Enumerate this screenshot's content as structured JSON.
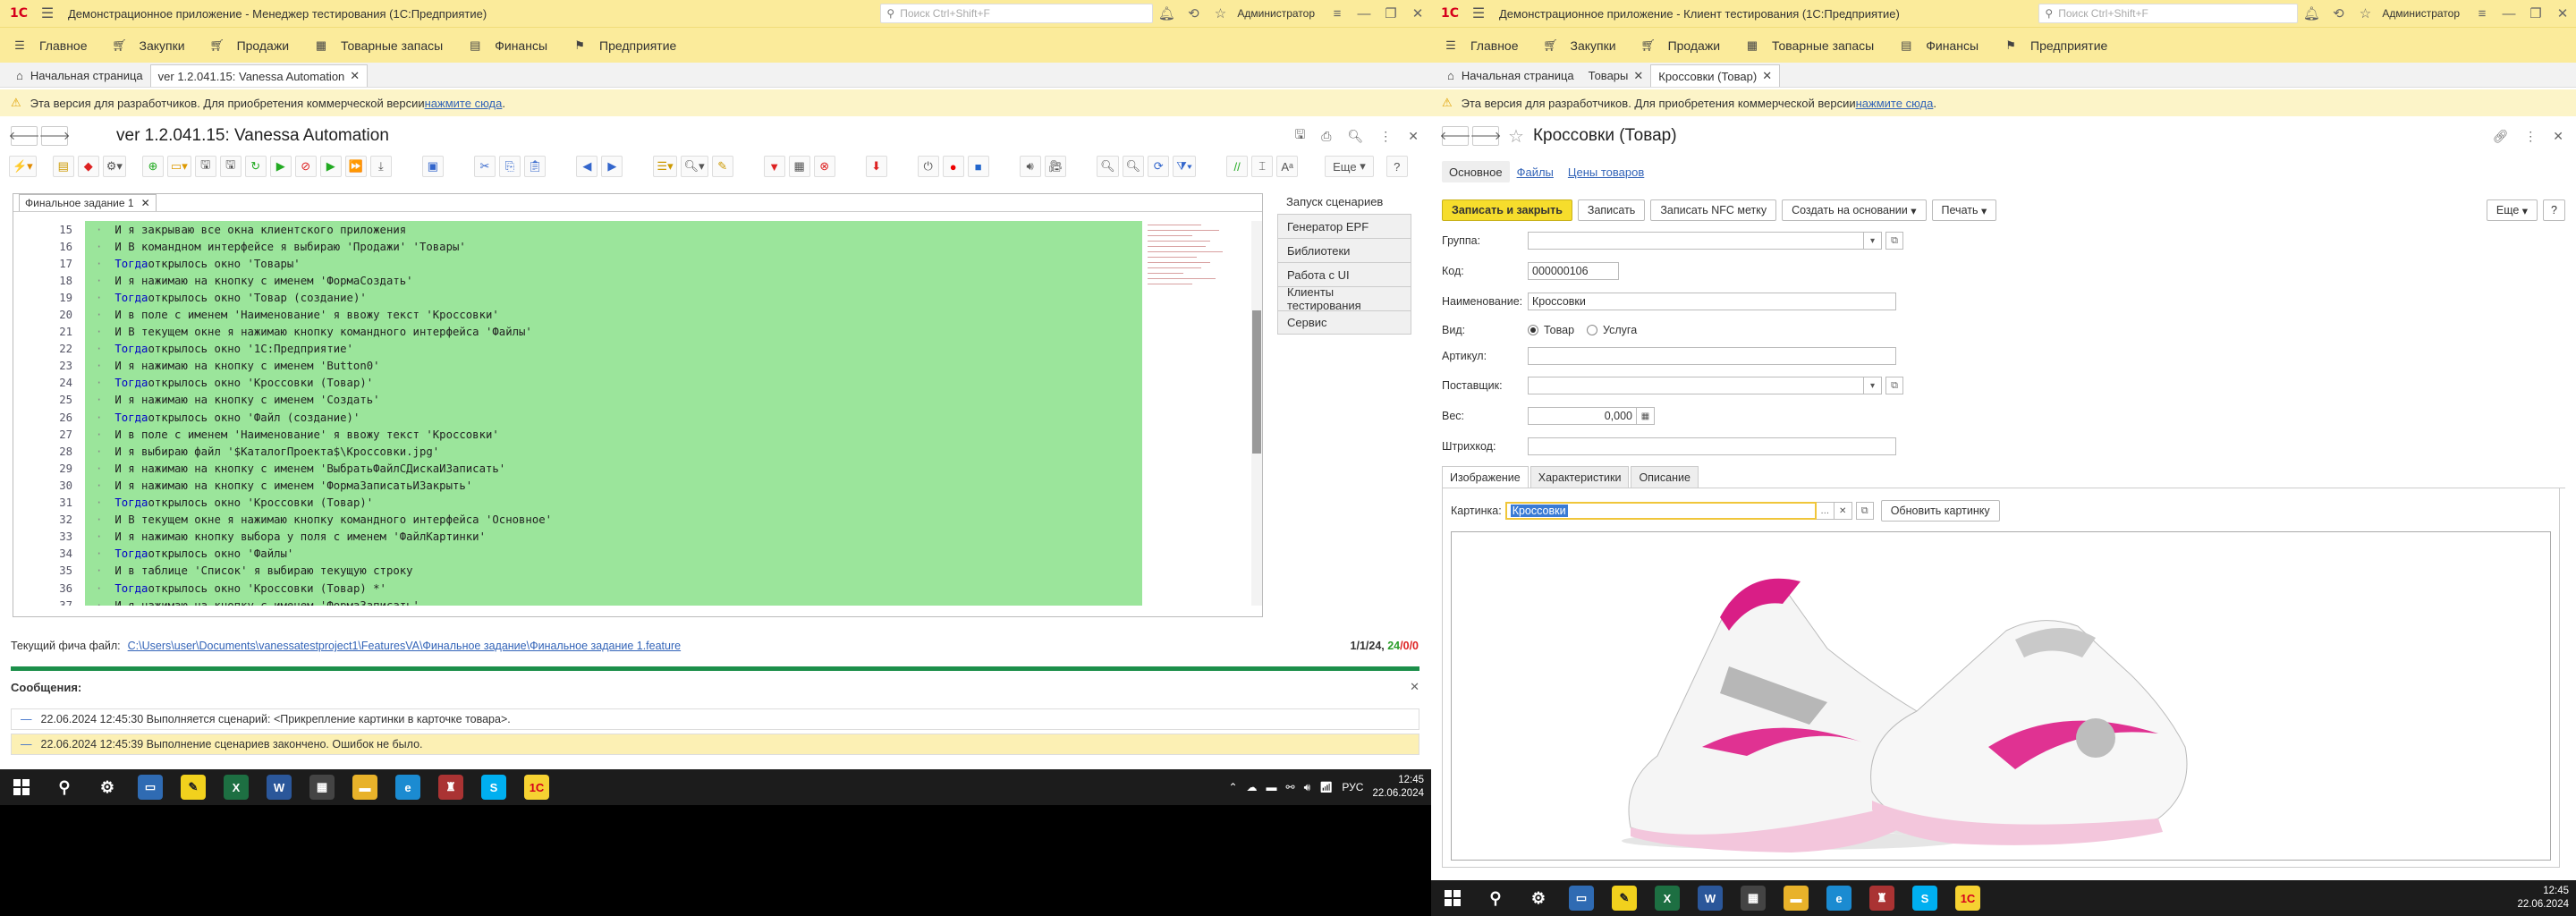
{
  "left": {
    "title": "Демонстрационное приложение - Менеджер тестирования (1С:Предприятие)",
    "search_placeholder": "Поиск Ctrl+Shift+F",
    "user": "Администратор",
    "menu": [
      "Главное",
      "Закупки",
      "Продажи",
      "Товарные запасы",
      "Финансы",
      "Предприятие"
    ],
    "tabs": [
      "Начальная страница",
      "ver 1.2.041.15: Vanessa Automation"
    ],
    "dev_notice": "Эта версия для разработчиков. Для приобретения коммерческой версии ",
    "dev_link": "нажмите сюда",
    "form_title": "ver 1.2.041.15: Vanessa Automation",
    "more_label": "Еще",
    "help_label": "?",
    "editor_tab": "Финальное задание 1",
    "code_lines": [
      {
        "n": "15",
        "kw": "",
        "text": "И я закрываю все окна клиентского приложения"
      },
      {
        "n": "16",
        "kw": "",
        "text": "И В командном интерфейсе я выбираю 'Продажи' 'Товары'"
      },
      {
        "n": "17",
        "kw": "Тогда",
        "text": " открылось окно 'Товары'"
      },
      {
        "n": "18",
        "kw": "",
        "text": "И я нажимаю на кнопку с именем 'ФормаСоздать'"
      },
      {
        "n": "19",
        "kw": "Тогда",
        "text": " открылось окно 'Товар (создание)'"
      },
      {
        "n": "20",
        "kw": "",
        "text": "И в поле с именем 'Наименование' я ввожу текст 'Кроссовки'"
      },
      {
        "n": "21",
        "kw": "",
        "text": "И В текущем окне я нажимаю кнопку командного интерфейса 'Файлы'"
      },
      {
        "n": "22",
        "kw": "Тогда",
        "text": " открылось окно '1С:Предприятие'"
      },
      {
        "n": "23",
        "kw": "",
        "text": "И я нажимаю на кнопку с именем 'Button0'"
      },
      {
        "n": "24",
        "kw": "Тогда",
        "text": " открылось окно 'Кроссовки (Товар)'"
      },
      {
        "n": "25",
        "kw": "",
        "text": "И я нажимаю на кнопку с именем 'Создать'"
      },
      {
        "n": "26",
        "kw": "Тогда",
        "text": " открылось окно 'Файл (создание)'"
      },
      {
        "n": "27",
        "kw": "",
        "text": "И в поле с именем 'Наименование' я ввожу текст 'Кроссовки'"
      },
      {
        "n": "28",
        "kw": "",
        "text": "И я выбираю файл '$КаталогПроекта$\\Кроссовки.jpg'"
      },
      {
        "n": "29",
        "kw": "",
        "text": "И я нажимаю на кнопку с именем 'ВыбратьФайлСДискаИЗаписать'"
      },
      {
        "n": "30",
        "kw": "",
        "text": "И я нажимаю на кнопку с именем 'ФормаЗаписатьИЗакрыть'"
      },
      {
        "n": "31",
        "kw": "Тогда",
        "text": " открылось окно 'Кроссовки (Товар)'"
      },
      {
        "n": "32",
        "kw": "",
        "text": "И В текущем окне я нажимаю кнопку командного интерфейса 'Основное'"
      },
      {
        "n": "33",
        "kw": "",
        "text": "И я нажимаю кнопку выбора у поля с именем 'ФайлКартинки'"
      },
      {
        "n": "34",
        "kw": "Тогда",
        "text": " открылось окно 'Файлы'"
      },
      {
        "n": "35",
        "kw": "",
        "text": "И в таблице 'Список' я выбираю текущую строку"
      },
      {
        "n": "36",
        "kw": "Тогда",
        "text": " открылось окно 'Кроссовки (Товар) *'"
      },
      {
        "n": "37",
        "kw": "",
        "text": "И я нажимаю на кнопку с именем 'ФормаЗаписать'"
      }
    ],
    "side_panel": [
      "Запуск сценариев",
      "Генератор EPF",
      "Библиотеки",
      "Работа с UI",
      "Клиенты тестирования",
      "Сервис"
    ],
    "feature_label": "Текущий фича файл:",
    "feature_path": "C:\\Users\\user\\Documents\\vanessatestproject1\\FeaturesVA\\Финальное задание\\Финальное задание 1.feature",
    "counts_prefix": "1/1/24, ",
    "counts_ok": "24",
    "counts_rest": "/0/0",
    "messages_title": "Сообщения:",
    "messages": [
      "22.06.2024 12:45:30 Выполняется сценарий: <Прикрепление картинки в карточке товара>.",
      "22.06.2024 12:45:39 Выполнение сценариев закончено. Ошибок не было."
    ],
    "tray_lang": "РУС",
    "clock_time": "12:45",
    "clock_date": "22.06.2024"
  },
  "right": {
    "title": "Демонстрационное приложение - Клиент тестирования (1С:Предприятие)",
    "search_placeholder": "Поиск Ctrl+Shift+F",
    "user": "Администратор",
    "menu": [
      "Главное",
      "Закупки",
      "Продажи",
      "Товарные запасы",
      "Финансы",
      "Предприятие"
    ],
    "tabs": [
      "Начальная страница",
      "Товары",
      "Кроссовки (Товар)"
    ],
    "dev_notice": "Эта версия для разработчиков. Для приобретения коммерческой версии ",
    "dev_link": "нажмите сюда",
    "form_title": "Кроссовки (Товар)",
    "form_tabs": [
      "Основное",
      "Файлы",
      "Цены товаров"
    ],
    "buttons": [
      "Записать и закрыть",
      "Записать",
      "Записать NFC метку",
      "Создать на основании",
      "Печать"
    ],
    "more_label": "Еще",
    "help_label": "?",
    "fields": {
      "group_label": "Группа:",
      "group_value": "",
      "code_label": "Код:",
      "code_value": "000000106",
      "name_label": "Наименование:",
      "name_value": "Кроссовки",
      "kind_label": "Вид:",
      "kind_opt1": "Товар",
      "kind_opt2": "Услуга",
      "article_label": "Артикул:",
      "article_value": "",
      "supplier_label": "Поставщик:",
      "supplier_value": "",
      "weight_label": "Вес:",
      "weight_value": "0,000",
      "barcode_label": "Штрихкод:",
      "barcode_value": ""
    },
    "subtabs": [
      "Изображение",
      "Характеристики",
      "Описание"
    ],
    "picture_label": "Картинка:",
    "picture_value": "Кроссовки",
    "refresh_button": "Обновить картинку",
    "clock_time": "12:45",
    "clock_date": "22.06.2024"
  },
  "colors": {
    "accent": "#fbeb9b",
    "code_bg": "#9be59b",
    "primary_btn": "#f6dd2c",
    "progress": "#1c8f4a"
  }
}
